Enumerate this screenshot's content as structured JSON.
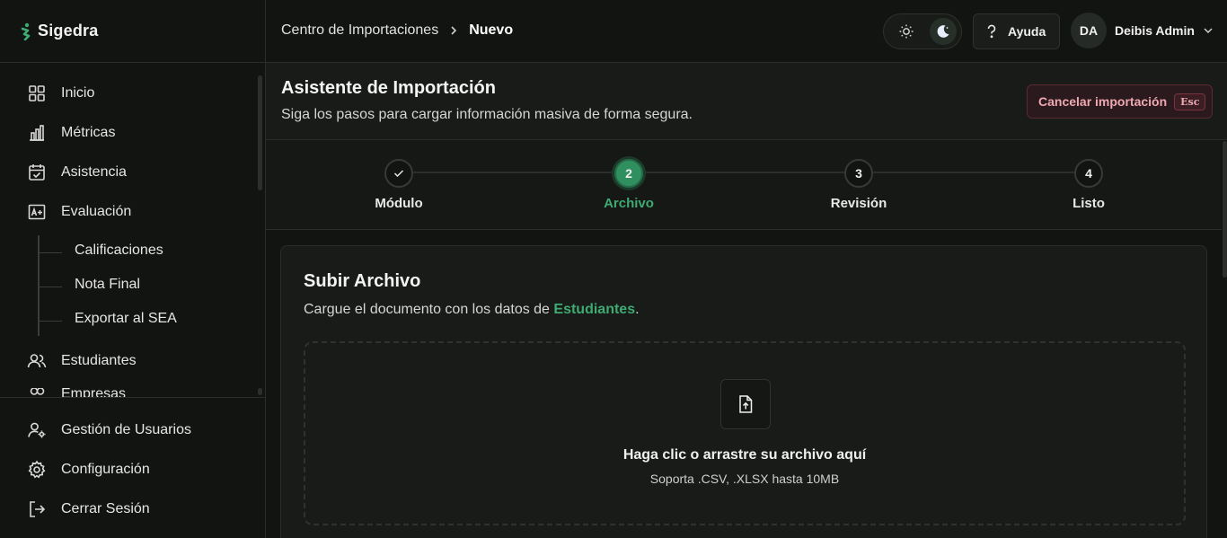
{
  "brand": {
    "name": "Sigedra"
  },
  "sidebar": {
    "items": [
      {
        "label": "Inicio",
        "icon": "grid-icon"
      },
      {
        "label": "Métricas",
        "icon": "bar-chart-icon"
      },
      {
        "label": "Asistencia",
        "icon": "calendar-check-icon"
      },
      {
        "label": "Evaluación",
        "icon": "grade-icon"
      },
      {
        "label": "Estudiantes",
        "icon": "users-icon"
      },
      {
        "label": "Empresas",
        "icon": "users-icon"
      }
    ],
    "sub_items": [
      {
        "label": "Calificaciones"
      },
      {
        "label": "Nota Final"
      },
      {
        "label": "Exportar al SEA"
      }
    ],
    "bottom": [
      {
        "label": "Gestión de Usuarios",
        "icon": "user-cog-icon"
      },
      {
        "label": "Configuración",
        "icon": "gear-icon"
      },
      {
        "label": "Cerrar Sesión",
        "icon": "logout-icon"
      }
    ]
  },
  "header": {
    "breadcrumb": [
      "Centro de Importaciones",
      "Nuevo"
    ],
    "help_label": "Ayuda",
    "user": {
      "initials": "DA",
      "name": "Deibis Admin"
    }
  },
  "page": {
    "title": "Asistente de Importación",
    "subtitle": "Siga los pasos para cargar información masiva de forma segura.",
    "cancel_label": "Cancelar importación",
    "cancel_shortcut": "Esc"
  },
  "stepper": {
    "steps": [
      {
        "number": "",
        "label": "Módulo",
        "state": "done"
      },
      {
        "number": "2",
        "label": "Archivo",
        "state": "active"
      },
      {
        "number": "3",
        "label": "Revisión",
        "state": "pending"
      },
      {
        "number": "4",
        "label": "Listo",
        "state": "pending"
      }
    ]
  },
  "upload": {
    "title": "Subir Archivo",
    "subtitle_prefix": "Cargue el documento con los datos de ",
    "subtitle_highlight": "Estudiantes",
    "subtitle_suffix": ".",
    "drop_text": "Haga clic o arrastre su archivo aquí",
    "drop_hint": "Soporta .CSV, .XLSX hasta 10MB"
  },
  "colors": {
    "accent": "#3faa72",
    "danger_text": "#f0a8b2",
    "background": "#121412"
  }
}
